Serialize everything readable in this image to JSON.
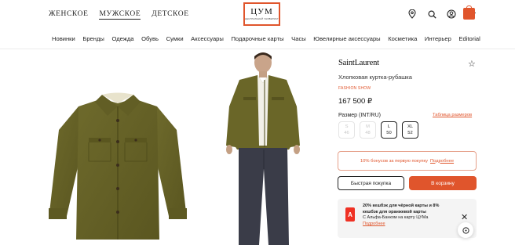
{
  "header": {
    "gender_tabs": [
      "ЖЕНСКОЕ",
      "МУЖСКОЕ",
      "ДЕТСКОЕ"
    ],
    "active_gender": "МУЖСКОЕ",
    "logo_main": "ЦУМ",
    "logo_sub": "ЦЕНТРАЛЬНЫЙ УНИВЕРМАГ",
    "icons": [
      "location-icon",
      "search-icon",
      "account-icon",
      "favorites-icon",
      "cart-icon"
    ],
    "accent": "#e0552c"
  },
  "categories": [
    "Новинки",
    "Бренды",
    "Одежда",
    "Обувь",
    "Сумки",
    "Аксессуары",
    "Подарочные карты",
    "Часы",
    "Ювелирные аксессуары",
    "Косметика",
    "Интерьер",
    "Editorial"
  ],
  "product": {
    "brand": "SaintLaurent",
    "name": "Хлопковая куртка-рубашка",
    "tag": "FASHION SHOW",
    "price": "167 500 ₽",
    "size_label": "Размер (INT/RU)",
    "size_table_link": "Таблица размеров",
    "sizes": [
      {
        "int": "S",
        "ru": "46",
        "available": false
      },
      {
        "int": "M",
        "ru": "48",
        "available": false
      },
      {
        "int": "L",
        "ru": "50",
        "available": true
      },
      {
        "int": "XL",
        "ru": "52",
        "available": true
      }
    ]
  },
  "bonus": {
    "text": "10% бонусов за первую покупку",
    "link": "Подробнее"
  },
  "buttons": {
    "quick_buy": "Быстрая покупка",
    "add_to_cart": "В корзину"
  },
  "promo": {
    "bank_letter": "А",
    "line1": "20% кешбэк для чёрной карты и 8%",
    "line2": "кешбэк для оранжевой карты",
    "line3": "С Альфа-Банком на карту ЦУМа",
    "link": "Подробнее"
  }
}
